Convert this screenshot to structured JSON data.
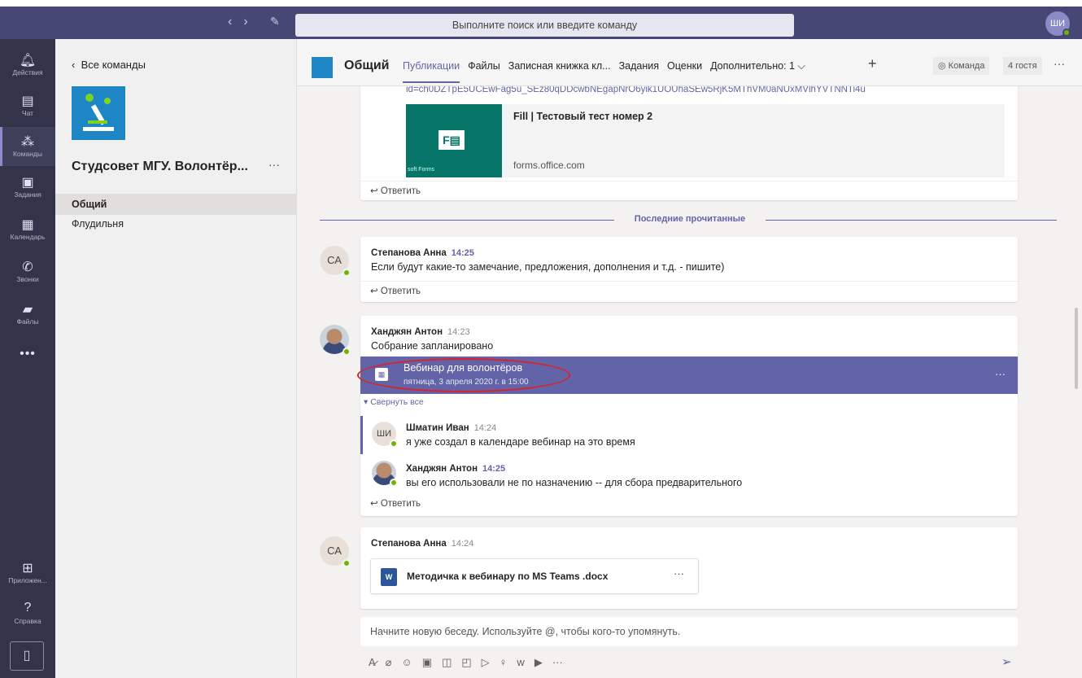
{
  "topbar": {
    "search_placeholder": "Выполните поиск или введите команду",
    "user_initials": "ШИ",
    "back_arrow": "‹",
    "forward_arrow": "›",
    "compose_icon": "✎"
  },
  "rail": {
    "items": [
      {
        "label": "Действия",
        "icon": "bell-icon"
      },
      {
        "label": "Чат",
        "icon": "chat-icon"
      },
      {
        "label": "Команды",
        "icon": "teams-icon"
      },
      {
        "label": "Задания",
        "icon": "assignments-icon"
      },
      {
        "label": "Календарь",
        "icon": "calendar-icon"
      },
      {
        "label": "Звонки",
        "icon": "phone-icon"
      },
      {
        "label": "Файлы",
        "icon": "files-icon"
      }
    ],
    "more": "•••",
    "apps_label": "Приложен...",
    "help_label": "Справка"
  },
  "team_pane": {
    "back_label": "Все команды",
    "team_name": "Студсовет МГУ. Волонтёр...",
    "more": "···",
    "channels": [
      "Общий",
      "Флудильня"
    ]
  },
  "channel_header": {
    "title": "Общий",
    "tabs": [
      "Публикации",
      "Файлы",
      "Записная книжка кл...",
      "Задания",
      "Оценки",
      "Дополнительно: 1 ⌵"
    ],
    "team_label": "Команда",
    "guests_label": "4 гостя",
    "plus": "+",
    "more": "···"
  },
  "feed": {
    "link_url": "id=ch0DZTpE5UCEwFag5u_SEz80qDDcwbNEgapNrO6yik1UOUhaSEw5RjK5MThVM0aNUxMVlhYVTNNTi4u",
    "preview_title": "Fill | Тестовый тест номер 2",
    "preview_domain": "forms.office.com",
    "preview_caption": "soft Forms",
    "reply_label": "Ответить",
    "last_read_label": "Последние прочитанные",
    "posts": [
      {
        "initials": "СА",
        "author": "Степанова Анна",
        "time": "14:25",
        "text": "Если будут какие-то замечание, предложения, дополнения и т.д. - пишите)"
      },
      {
        "author": "Ханджян Антон",
        "time": "14:23",
        "text": "Собрание запланировано"
      },
      {
        "initials": "СА",
        "author": "Степанова Анна",
        "time": "14:24"
      }
    ],
    "meeting": {
      "title": "Вебинар для волонтёров",
      "date": "пятница, 3 апреля 2020 г. в 15:00",
      "more": "···"
    },
    "collapse_label": "Свернуть все",
    "replies": [
      {
        "initials": "ШИ",
        "author": "Шматин Иван",
        "time": "14:24",
        "text": "я уже создал в календаре вебинар на это время"
      },
      {
        "author": "Ханджян Антон",
        "time": "14:25",
        "text": "вы его использовали не по назначению -- для сбора предварительного"
      }
    ],
    "file_name": "Методичка к вебинару по MS Teams .docx",
    "file_more": "···"
  },
  "composer": {
    "placeholder": "Начните новую беседу. Используйте @, чтобы кого-то упомянуть.",
    "tools": [
      "format-icon",
      "attach-icon",
      "emoji-icon",
      "gif-icon",
      "sticker-icon",
      "meet-icon",
      "stream-icon",
      "praise-icon",
      "wiki-icon",
      "youtube-icon",
      "more-icon"
    ]
  },
  "colors": {
    "accent": "#6264a7",
    "topbar": "#464775",
    "rail": "#33344a",
    "highlight": "#d8232a"
  }
}
